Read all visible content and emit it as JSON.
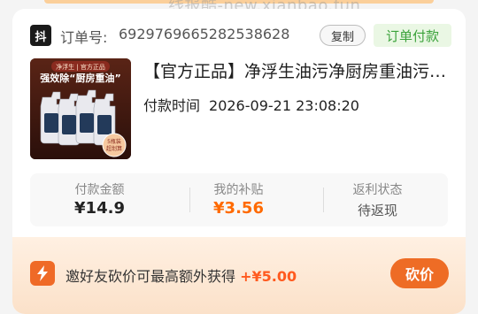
{
  "watermark": "线报酷-new.xianbao.fun",
  "order": {
    "platform_badge": "抖",
    "label": "订单号:",
    "number": "6929769665282538628",
    "copy_label": "复制",
    "status": "订单付款"
  },
  "product": {
    "title": "【官方正品】净浮生油污净厨房重油污清洁剂",
    "image": {
      "brand": "净浮生 | 官方正品",
      "slogan": "强效除“厨房重油”",
      "badge_line1": "5瓶装",
      "badge_line2": "超划算"
    }
  },
  "paytime": {
    "label": "付款时间",
    "value": "2026-09-21 23:08:20"
  },
  "stats": {
    "paid_label": "付款金额",
    "paid_value": "¥14.9",
    "subsidy_label": "我的补贴",
    "subsidy_value": "¥3.56",
    "rebate_label": "返利状态",
    "rebate_value": "待返现"
  },
  "promo": {
    "text": "邀好友砍价可最高额外获得",
    "amount": "+¥5.00",
    "button": "砍价"
  },
  "colors": {
    "accent": "#ee6c25",
    "subsidy": "#ff6a00",
    "status_green": "#3aa23a"
  }
}
